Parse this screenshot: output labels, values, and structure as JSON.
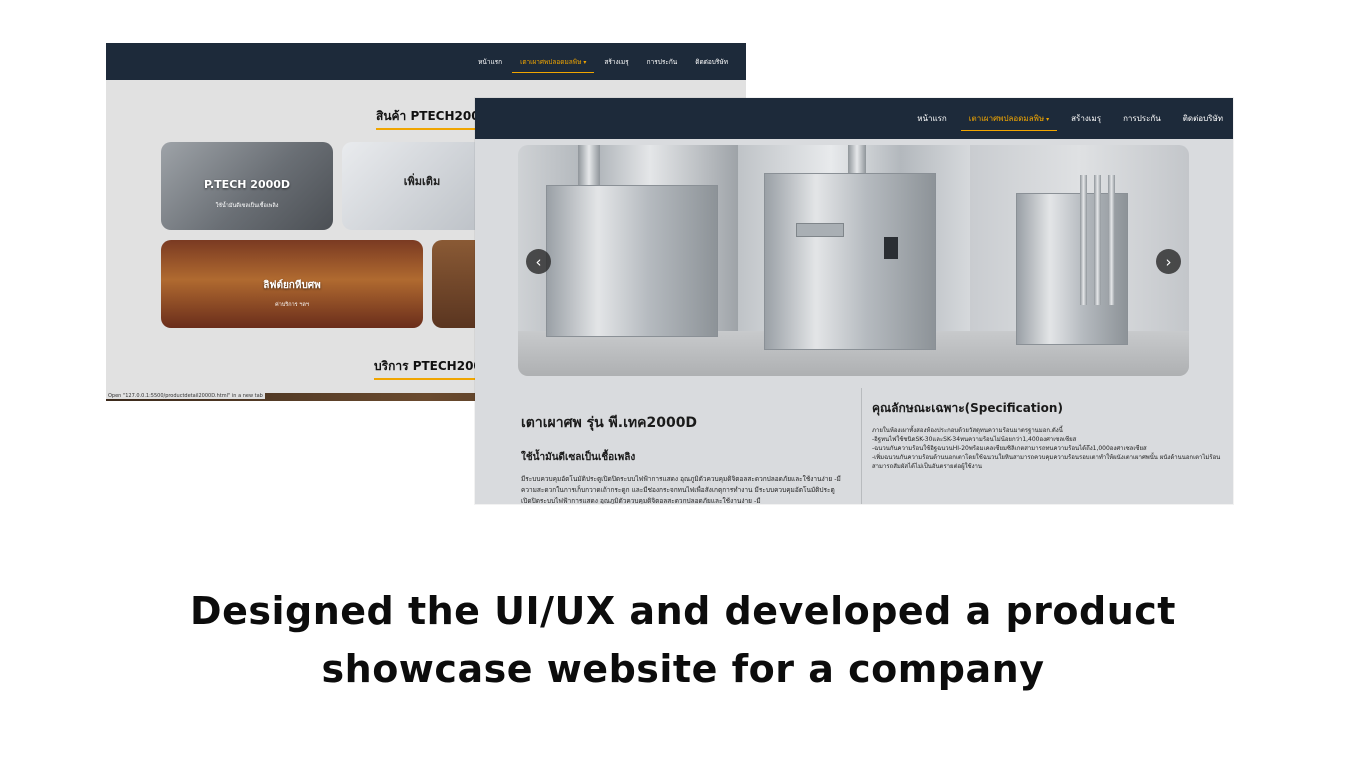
{
  "back": {
    "nav": [
      "หน้าแรก",
      "เตาเผาศพปลอดมลพิษ",
      "สร้างเมรุ",
      "การประกัน",
      "ติดต่อบริษัท"
    ],
    "section_title": "สินค้า PTECH2000",
    "section_title2": "บริการ PTECH2000",
    "cards": [
      {
        "title": "P.TECH 2000D",
        "subtitle": "ใช้น้ำมันดีเซลเป็นเชื้อเพลิง"
      },
      {
        "title": "เพิ่มเติม",
        "subtitle": ""
      },
      {
        "title": "ลิฟต์ยกหีบศพ",
        "subtitle": "ค่าบริการ ฯลฯ"
      }
    ],
    "status_url": "Open \"127.0.0.1:5500/productdetail2000D.html\" in a new tab"
  },
  "front": {
    "nav": [
      "หน้าแรก",
      "เตาเผาศพปลอดมลพิษ",
      "สร้างเมรุ",
      "การประกัน",
      "ติดต่อบริษัท"
    ],
    "carousel": {
      "prev": "‹",
      "next": "›"
    },
    "product_title": "เตาเผาศพ รุ่น พี.เทค2000D",
    "product_subtitle": "ใช้น้ำมันดีเซลเป็นเชื้อเพลิง",
    "product_desc": "มีระบบควบคุมอัตโนมัติประตูเปิดปิดระบบไฟฟ้าการแสดง อุณภูมิตัวควบคุมดิจิตอลสะดวกปลอดภัยและใช้งานง่าย -มีความสะดวกในการเก็บกวาดเถ้ากระดูก และมีช่องกระจกทนไฟเพื่อสังเกตุการทำงาน มีระบบควบคุมอัตโนมัติประตูเปิดปิดระบบไฟฟ้าการแสดง อุณภูมิตัวควบคุมดิจิตอลสะดวกปลอดภัยและใช้งานง่าย -มี",
    "spec_title": "คุณลักษณะเฉพาะ(Specification)",
    "spec": [
      "ภายในห้องเผาทั้งสองห้องประกอบด้วยวัสดุทนความร้อนมาตรฐานมอก.ดังนี้",
      "-อิฐทนไฟใช้ชนิดSK-30และSK-34ทนความร้อนไม่น้อยกว่า1,400องศาเซลเซียส",
      "-ฉนวนกันความร้อนใช้อิฐฉนวนHI-20พร้อมเคลเซียมซิลิเกตสามารถทนความร้อนได้ถึง1,000องศาเซลเซียส",
      "-เพิ่มฉนวนกันความร้อนด้านนอกเตาโดยใช้ฉนวนใยหินสามารถควบคุมความร้อนรอบเตาทำให้ผนังเตาเผาศพนั้น ผนังด้านนอกเตาไม่ร้อนสามารถสัมผัสได้ไม่เป็นอันตรายต่อผู้ใช้งาน"
    ]
  },
  "caption": {
    "line1": "Designed the UI/UX and developed a product",
    "line2": "showcase website for a company"
  }
}
